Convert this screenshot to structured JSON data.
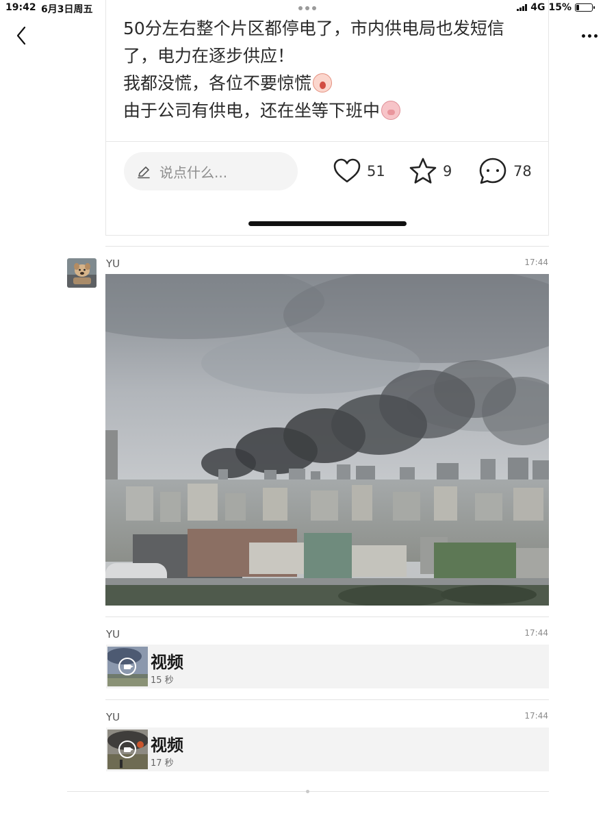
{
  "status_bar": {
    "time": "19:42",
    "date": "6月3日周五",
    "network": "4G",
    "battery": "15%",
    "battery_level": 0.15
  },
  "nav": {
    "back_icon": "chevron-left-icon",
    "more_icon": "ellipsis-icon"
  },
  "post": {
    "lines": [
      "50分左右整个片区都停电了，市内供电局也发短信",
      "了，电力在逐步供应！",
      "我都没慌，各位不要惊慌",
      "由于公司有供电，还在坐等下班中"
    ],
    "comment_placeholder": "说点什么...",
    "likes": "51",
    "favorites": "9",
    "comments": "78"
  },
  "messages": [
    {
      "sender": "YU",
      "time": "17:44",
      "type": "image"
    },
    {
      "sender": "YU",
      "time": "17:44",
      "type": "video",
      "title": "视频",
      "duration": "15 秒"
    },
    {
      "sender": "YU",
      "time": "17:44",
      "type": "video",
      "title": "视频",
      "duration": "17 秒"
    }
  ],
  "colors": {
    "smoke": "#3b3d40",
    "sky": "#b9bec3",
    "bubble": "#f3f3f3"
  }
}
